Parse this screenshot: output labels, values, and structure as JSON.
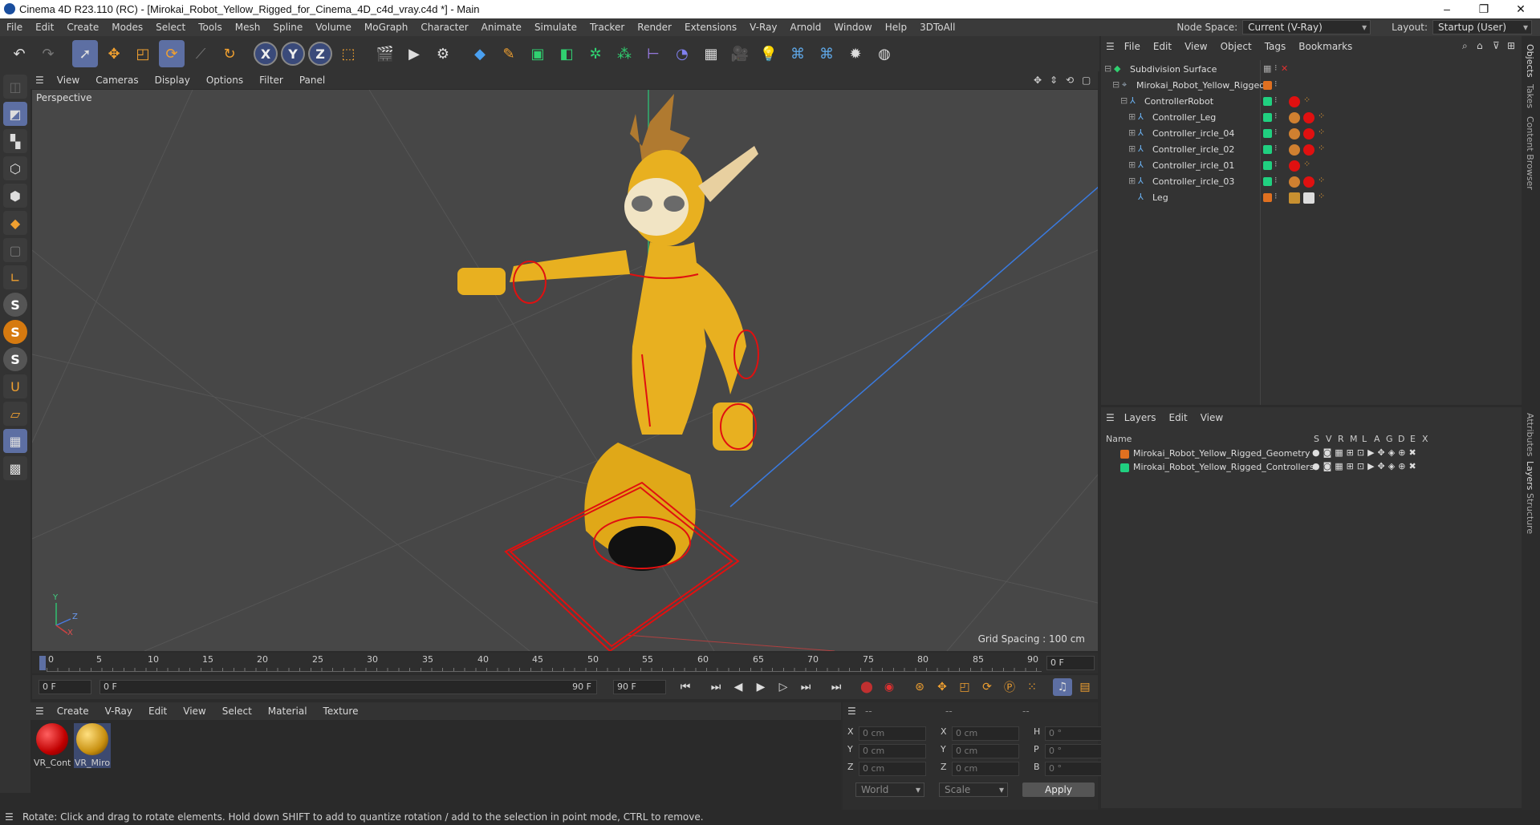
{
  "window": {
    "title": "Cinema 4D R23.110 (RC) - [Mirokai_Robot_Yellow_Rigged_for_Cinema_4D_c4d_vray.c4d *] - Main",
    "minimize": "–",
    "maximize": "❐",
    "close": "✕"
  },
  "menubar": {
    "items": [
      "File",
      "Edit",
      "Create",
      "Modes",
      "Select",
      "Tools",
      "Mesh",
      "Spline",
      "Volume",
      "MoGraph",
      "Character",
      "Animate",
      "Simulate",
      "Tracker",
      "Render",
      "Extensions",
      "V-Ray",
      "Arnold",
      "Window",
      "Help",
      "3DToAll"
    ],
    "node_space_label": "Node Space:",
    "node_space_value": "Current (V-Ray)",
    "layout_label": "Layout:",
    "layout_value": "Startup (User)"
  },
  "toolbar": {
    "x_axis": "X",
    "y_axis": "Y",
    "z_axis": "Z"
  },
  "viewport_menu": {
    "items": [
      "View",
      "Cameras",
      "Display",
      "Options",
      "Filter",
      "Panel"
    ]
  },
  "viewport": {
    "label": "Perspective",
    "grid_spacing": "Grid Spacing : 100 cm",
    "axis_y": "Y",
    "axis_z": "Z",
    "axis_x": "X"
  },
  "timeline": {
    "ticks": [
      "0",
      "5",
      "10",
      "15",
      "20",
      "25",
      "30",
      "35",
      "40",
      "45",
      "50",
      "55",
      "60",
      "65",
      "70",
      "75",
      "80",
      "85",
      "90"
    ],
    "current_frame": "0 F"
  },
  "transport": {
    "start_field": "0 F",
    "range_start": "0 F",
    "range_end": "90 F",
    "end_field": "90 F"
  },
  "material_menu": {
    "items": [
      "Create",
      "V-Ray",
      "Edit",
      "View",
      "Select",
      "Material",
      "Texture"
    ]
  },
  "materials": [
    {
      "label": "VR_Cont",
      "color": "#e01010"
    },
    {
      "label": "VR_Miro",
      "color": "#d8a020"
    }
  ],
  "coordinates": {
    "header_dashes": [
      "--",
      "--",
      "--"
    ],
    "rows": [
      {
        "a": "X",
        "av": "0 cm",
        "b": "X",
        "bv": "0 cm",
        "c": "H",
        "cv": "0 °"
      },
      {
        "a": "Y",
        "av": "0 cm",
        "b": "Y",
        "bv": "0 cm",
        "c": "P",
        "cv": "0 °"
      },
      {
        "a": "Z",
        "av": "0 cm",
        "b": "Z",
        "bv": "0 cm",
        "c": "B",
        "cv": "0 °"
      }
    ],
    "space": "World",
    "mode": "Scale",
    "apply": "Apply"
  },
  "objects_panel": {
    "menu": [
      "File",
      "Edit",
      "View",
      "Object",
      "Tags",
      "Bookmarks"
    ],
    "rows": [
      {
        "name": "Subdivision Surface",
        "indent": 0
      },
      {
        "name": "Mirokai_Robot_Yellow_Rigged",
        "indent": 1
      },
      {
        "name": "ControllerRobot",
        "indent": 2
      },
      {
        "name": "Controller_Leg",
        "indent": 3
      },
      {
        "name": "Controller_ircle_04",
        "indent": 3
      },
      {
        "name": "Controller_ircle_02",
        "indent": 3
      },
      {
        "name": "Controller_ircle_01",
        "indent": 3
      },
      {
        "name": "Controller_ircle_03",
        "indent": 3
      },
      {
        "name": "Leg",
        "indent": 3
      }
    ]
  },
  "layers_panel": {
    "menu": [
      "Layers",
      "Edit",
      "View"
    ],
    "header_name": "Name",
    "header_flags": [
      "S",
      "V",
      "R",
      "M",
      "L",
      "A",
      "G",
      "D",
      "E",
      "X"
    ],
    "rows": [
      {
        "name": "Mirokai_Robot_Yellow_Rigged_Geometry",
        "color": "#e07020"
      },
      {
        "name": "Mirokai_Robot_Yellow_Rigged_Controllers",
        "color": "#20d080"
      }
    ]
  },
  "right_tabs": [
    "Objects",
    "Takes",
    "Content Browser",
    "Attributes",
    "Layers",
    "Structure"
  ],
  "status": "Rotate: Click and drag to rotate elements. Hold down SHIFT to add to quantize rotation / add to the selection in point mode, CTRL to remove."
}
